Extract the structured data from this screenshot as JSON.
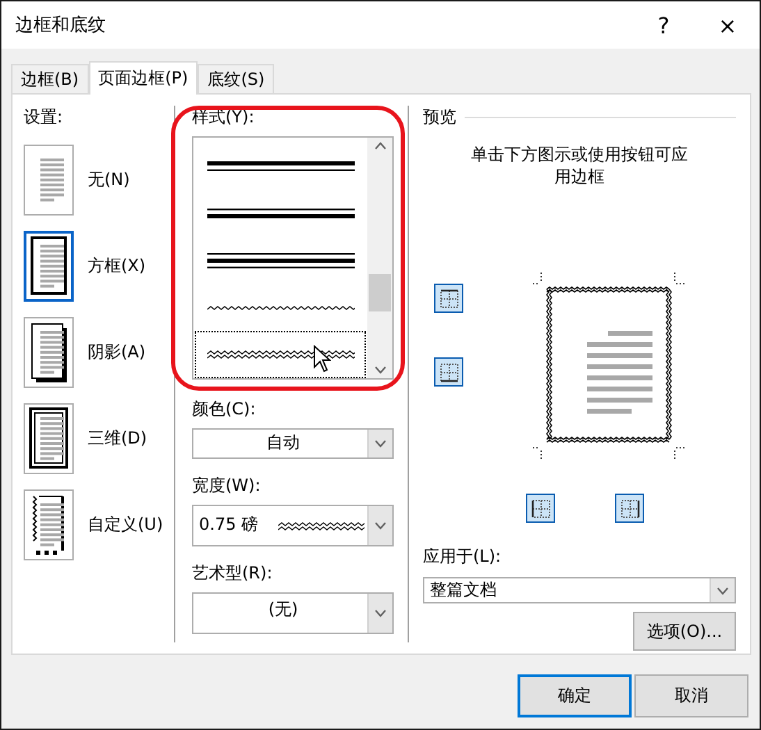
{
  "window": {
    "title": "边框和底纹",
    "help": "?",
    "close": "×"
  },
  "tabs": [
    {
      "label": "边框(B)",
      "selected": false
    },
    {
      "label": "页面边框(P)",
      "selected": true
    },
    {
      "label": "底纹(S)",
      "selected": false
    }
  ],
  "settings": {
    "label": "设置:",
    "items": [
      {
        "kind": "none",
        "label": "无(N)",
        "selected": false
      },
      {
        "kind": "box",
        "label": "方框(X)",
        "selected": true
      },
      {
        "kind": "shadow",
        "label": "阴影(A)",
        "selected": false
      },
      {
        "kind": "threed",
        "label": "三维(D)",
        "selected": false
      },
      {
        "kind": "custom",
        "label": "自定义(U)",
        "selected": false
      }
    ]
  },
  "style": {
    "label": "样式(Y):",
    "items": [
      {
        "kind": "thick-thin",
        "selected": false
      },
      {
        "kind": "thin-thick",
        "selected": false
      },
      {
        "kind": "thin-thick-thin",
        "selected": false
      },
      {
        "kind": "wave",
        "selected": false
      },
      {
        "kind": "double-wave",
        "selected": true
      }
    ]
  },
  "color": {
    "label": "颜色(C):",
    "value": "自动"
  },
  "width": {
    "label": "宽度(W):",
    "value": "0.75 磅"
  },
  "art": {
    "label": "艺术型(R):",
    "value": "(无)"
  },
  "preview": {
    "label": "预览",
    "hint": "单击下方图示或使用按钮可应用边框",
    "edge_buttons": [
      {
        "kind": "top",
        "on": true
      },
      {
        "kind": "bottom",
        "on": true
      },
      {
        "kind": "left",
        "on": true
      },
      {
        "kind": "right",
        "on": true
      }
    ]
  },
  "apply_to": {
    "label": "应用于(L):",
    "value": "整篇文档"
  },
  "options_button": "选项(O)...",
  "buttons": [
    {
      "label": "确定",
      "selected": true
    },
    {
      "label": "取消",
      "selected": false
    }
  ]
}
